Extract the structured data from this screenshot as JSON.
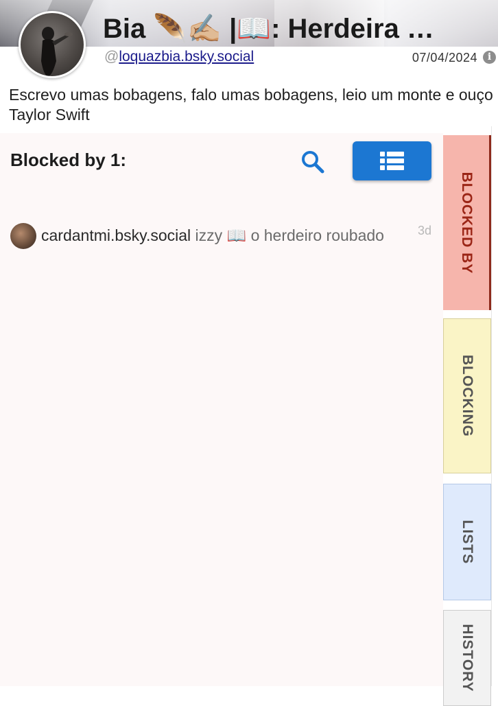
{
  "profile": {
    "display_name": "Bia 🪶✍🏼 |📖: Herdeira …",
    "handle_prefix": "@",
    "handle": "loquazbia.bsky.social",
    "joined_date": "07/04/2024",
    "info_icon": "i",
    "bio": "Escrevo umas bobagens, falo umas bobagens, leio um monte e ouço Taylor Swift"
  },
  "panel": {
    "title": "Blocked by 1:",
    "search_icon": "search-icon",
    "list_view_icon": "list-view-icon",
    "accent_color": "#1c77d2",
    "background_color": "#fdf8f8"
  },
  "entries": [
    {
      "handle": "cardantmi.bsky.social",
      "description": "izzy 📖 o herdeiro roubado",
      "time": "3d"
    }
  ],
  "tabs": [
    {
      "label": "BLOCKED BY",
      "color": "#f6b5ac",
      "active": true
    },
    {
      "label": "BLOCKING",
      "color": "#faf4c6",
      "active": false
    },
    {
      "label": "LISTS",
      "color": "#dfeafc",
      "active": false
    },
    {
      "label": "HISTORY",
      "color": "#f2f2f2",
      "active": false
    }
  ]
}
